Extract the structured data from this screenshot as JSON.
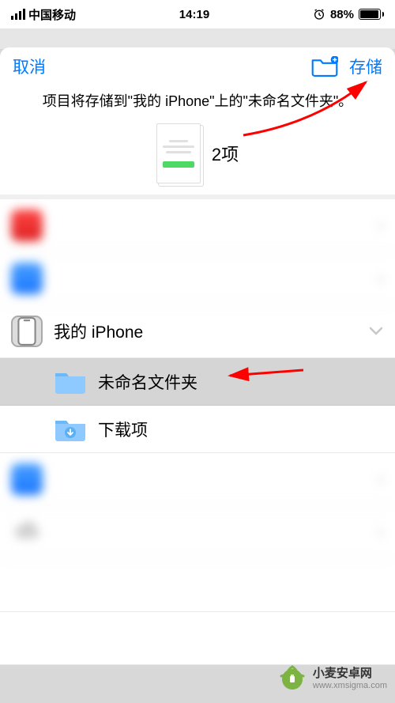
{
  "status": {
    "carrier": "中国移动",
    "time": "14:19",
    "battery_pct": "88%"
  },
  "header": {
    "cancel": "取消",
    "save": "存储"
  },
  "description": "项目将存储到\"我的 iPhone\"上的\"未命名文件夹\"。",
  "preview": {
    "count": "2项"
  },
  "locations": [
    {
      "label": " ",
      "icon": "red"
    },
    {
      "label": " ",
      "icon": "blue"
    },
    {
      "label": "我的 iPhone",
      "icon": "phone",
      "expanded": true
    },
    {
      "label": " ",
      "icon": "blue"
    },
    {
      "label": " ",
      "icon": "cloud"
    }
  ],
  "folders": [
    {
      "label": "未命名文件夹",
      "selected": true
    },
    {
      "label": "下载项",
      "selected": false
    }
  ],
  "watermark": {
    "title": "小麦安卓网",
    "url": "www.xmsigma.com"
  }
}
